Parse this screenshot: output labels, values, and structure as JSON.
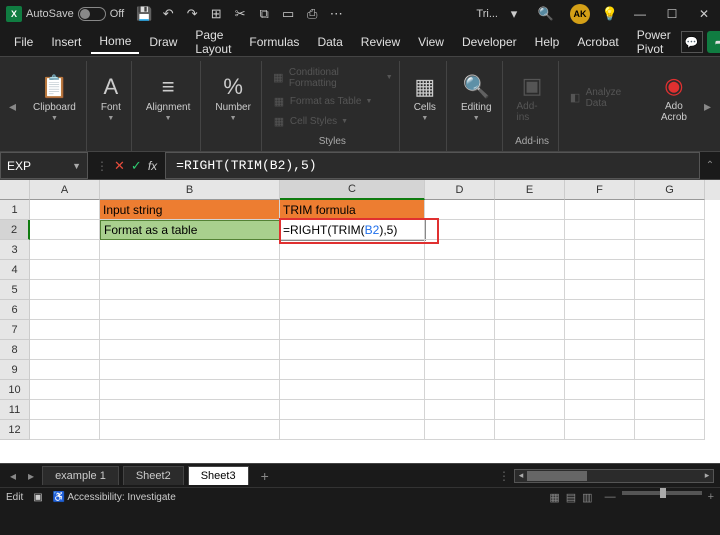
{
  "titlebar": {
    "app_icon": "X",
    "autosave_label": "AutoSave",
    "autosave_state": "Off",
    "doc_title": "Tri...",
    "avatar_initials": "AK"
  },
  "menu": {
    "tabs": [
      "File",
      "Insert",
      "Home",
      "Draw",
      "Page Layout",
      "Formulas",
      "Data",
      "Review",
      "View",
      "Developer",
      "Help",
      "Acrobat",
      "Power Pivot"
    ],
    "active": "Home"
  },
  "ribbon": {
    "clipboard": "Clipboard",
    "font": "Font",
    "alignment": "Alignment",
    "number": "Number",
    "cond_fmt": "Conditional Formatting",
    "fmt_table": "Format as Table",
    "cell_styles": "Cell Styles",
    "styles": "Styles",
    "cells": "Cells",
    "editing": "Editing",
    "addins": "Add-ins",
    "addins_label": "Add-ins",
    "analyze": "Analyze Data",
    "adobe1": "Ado",
    "adobe2": "Acrob"
  },
  "formula_bar": {
    "name_box": "EXP",
    "formula": "=RIGHT(TRIM(B2),5)"
  },
  "grid": {
    "columns": [
      "A",
      "B",
      "C",
      "D",
      "E",
      "F",
      "G"
    ],
    "rows": [
      "1",
      "2",
      "3",
      "4",
      "5",
      "6",
      "7",
      "8",
      "9",
      "10",
      "11",
      "12"
    ],
    "b1": "Input string",
    "c1": "TRIM formula",
    "b2": "Format as a   table",
    "c2_pre": "=RIGHT(TRIM(",
    "c2_ref": "B2",
    "c2_post": "),5)"
  },
  "sheets": {
    "tabs": [
      "example 1",
      "Sheet2",
      "Sheet3"
    ],
    "active": "Sheet3"
  },
  "status": {
    "mode": "Edit",
    "accessibility": "Accessibility: Investigate"
  }
}
